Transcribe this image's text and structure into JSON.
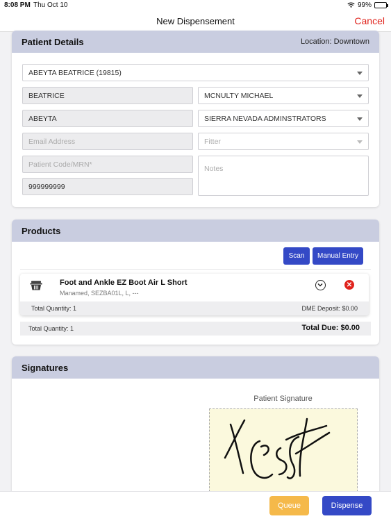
{
  "status_bar": {
    "time": "8:08 PM",
    "date": "Thu Oct 10",
    "battery": "99%",
    "battery_level": 0.99
  },
  "nav": {
    "title": "New Dispensement",
    "cancel": "Cancel"
  },
  "patient_details": {
    "heading": "Patient Details",
    "location": "Location: Downtown",
    "patient_select": "ABEYTA BEATRICE (19815)",
    "first_name": "BEATRICE",
    "last_name": "ABEYTA",
    "email_placeholder": "Email Address",
    "patient_code_placeholder": "Patient Code/MRN*",
    "phone": "999999999",
    "physician": "MCNULTY MICHAEL",
    "insurance": "SIERRA NEVADA ADMINSTRATORS",
    "fitter_placeholder": "Fitter",
    "notes_placeholder": "Notes"
  },
  "products": {
    "heading": "Products",
    "scan_label": "Scan",
    "manual_entry_label": "Manual Entry",
    "items": [
      {
        "name": "Foot and Ankle EZ Boot Air L Short",
        "description": "Manamed, SEZBA01L, L, ---",
        "quantity_text": "Total Quantity: 1",
        "deposit_text": "DME Deposit: $0.00"
      }
    ],
    "total_quantity": "Total Quantity: 1",
    "total_due": "Total Due: $0.00"
  },
  "signatures": {
    "heading": "Signatures",
    "patient_signature_label": "Patient Signature"
  },
  "actions": {
    "queue": "Queue",
    "dispense": "Dispense"
  },
  "colors": {
    "header_band": "#c9cde0",
    "primary_blue": "#3449c6",
    "queue_orange": "#f5b94a",
    "cancel_red": "#e0231c",
    "signature_pad": "#fbf9dd"
  },
  "icons": {
    "wifi": "wifi-icon",
    "battery": "battery-icon",
    "basket": "basket-icon",
    "chevron": "chevron-down-circle-icon",
    "remove": "remove-circle-icon"
  }
}
